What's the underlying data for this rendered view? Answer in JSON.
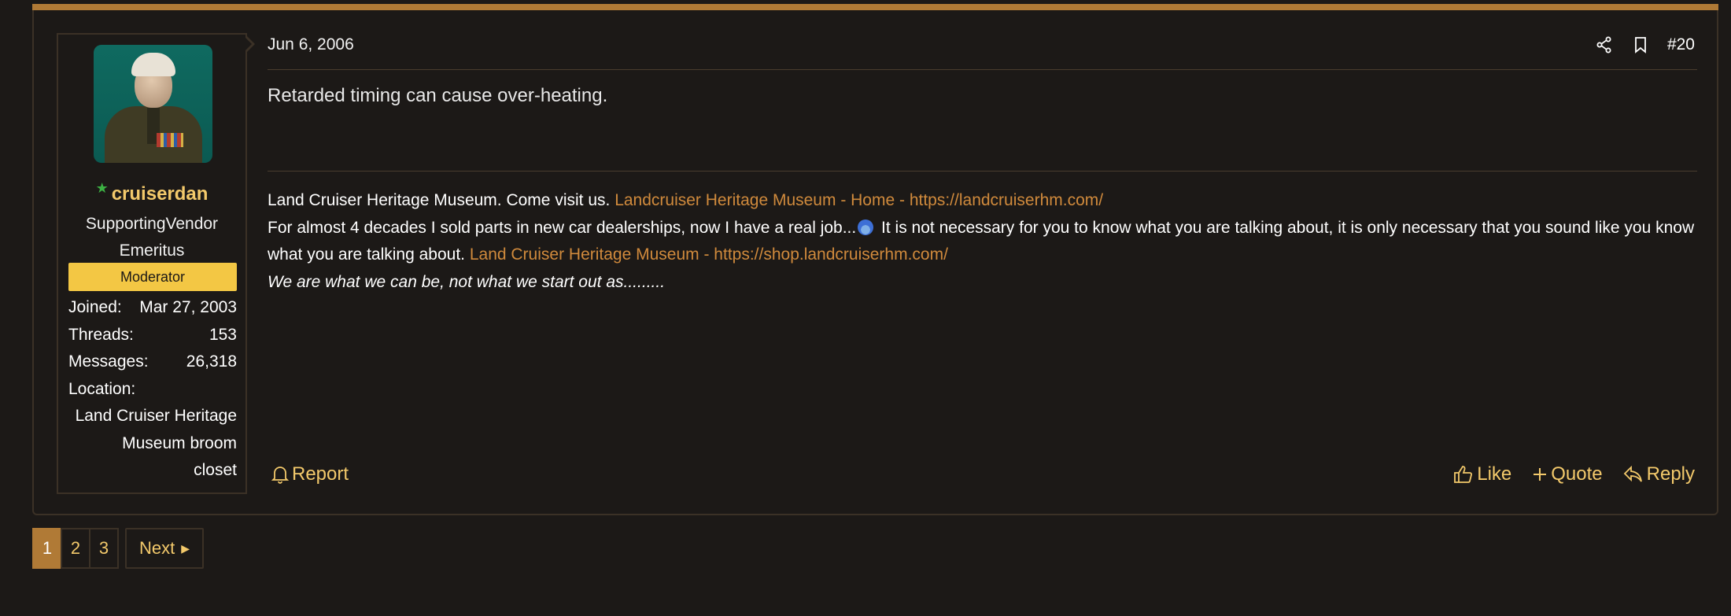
{
  "post": {
    "date": "Jun 6, 2006",
    "number": "#20",
    "message": "Retarded timing can cause over-heating."
  },
  "user": {
    "username": "cruiserdan",
    "title_lines": [
      "SupportingVendor",
      "Emeritus"
    ],
    "badge": "Moderator",
    "stats": [
      {
        "label": "Joined:",
        "value": "Mar 27, 2003"
      },
      {
        "label": "Threads:",
        "value": "153"
      },
      {
        "label": "Messages:",
        "value": "26,318"
      },
      {
        "label": "Location:",
        "value": ""
      }
    ],
    "location_lines": [
      "Land Cruiser Heritage",
      "Museum broom",
      "closet"
    ]
  },
  "signature": {
    "line1_text": "Land Cruiser Heritage Museum. Come visit us.",
    "line1_link": "Landcruiser Heritage Museum - Home - https://landcruiserhm.com/",
    "line2_text_a": "For almost 4 decades I sold parts in new car dealerships, now I have a real job...",
    "line2_text_b": " It is not necessary for you to know what you are talking about, it is only necessary that you sound like you know what you are talking about.",
    "line2_link": "Land Cruiser Heritage Museum - https://shop.landcruiserhm.com/",
    "line3_quote": "We are what we can be, not what we start out as........."
  },
  "actions": {
    "report": "Report",
    "like": "Like",
    "quote": "Quote",
    "reply": "Reply"
  },
  "pagination": {
    "pages": [
      "1",
      "2",
      "3"
    ],
    "current": "1",
    "next": "Next"
  },
  "colors": {
    "accent": "#b07a36",
    "link": "#d08a3c",
    "username": "#f3c96b",
    "badge": "#f3c744",
    "background": "#1c1917"
  },
  "icons": {
    "share": "share-icon",
    "bookmark": "bookmark-icon",
    "report": "bell-icon",
    "like": "thumbs-up-icon",
    "quote": "plus-icon",
    "reply": "reply-icon",
    "next": "caret-right-icon",
    "emoji": "grin-emoji-icon"
  }
}
